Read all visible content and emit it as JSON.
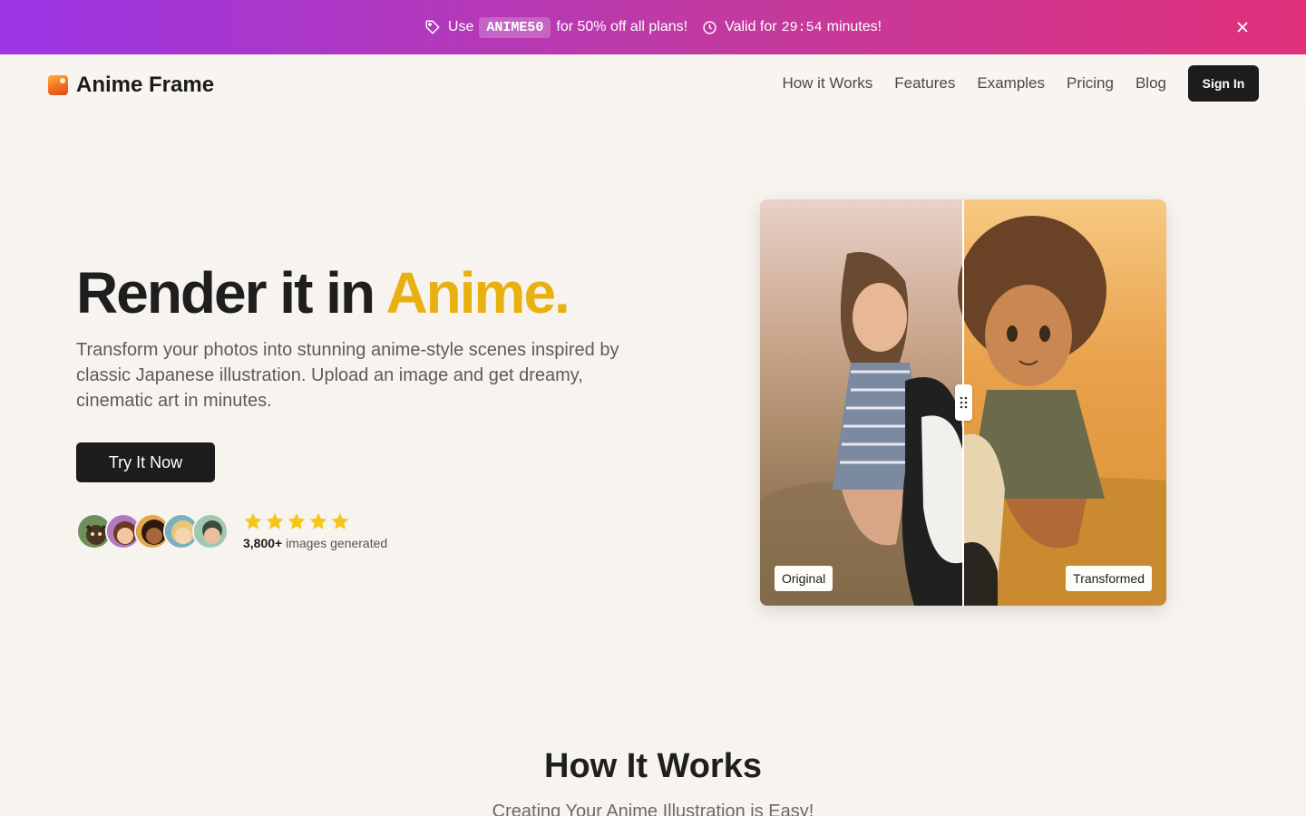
{
  "promo": {
    "use_text": "Use",
    "code": "ANIME50",
    "offer_text": "for 50% off all plans!",
    "valid_prefix": "Valid for",
    "timer": "29:54",
    "valid_suffix": "minutes!",
    "icons": {
      "tag": "tag-icon",
      "clock": "clock-icon",
      "close": "close-icon"
    },
    "gradient": [
      "#9b35e6",
      "#e0307a"
    ]
  },
  "nav": {
    "brand": "Anime Frame",
    "links": [
      "How it Works",
      "Features",
      "Examples",
      "Pricing",
      "Blog"
    ],
    "signin": "Sign In"
  },
  "hero": {
    "title_main": "Render it in ",
    "title_accent": "Anime.",
    "accent_color": "#e8b10f",
    "subtitle": "Transform your photos into stunning anime-style scenes inspired by classic Japanese illustration. Upload an image and get dreamy, cinematic art in minutes.",
    "cta": "Try It Now",
    "rating_stars": 5,
    "count": "3,800+",
    "count_label": "images generated"
  },
  "compare": {
    "left_label": "Original",
    "right_label": "Transformed"
  },
  "how": {
    "title": "How It Works",
    "subtitle": "Creating Your Anime Illustration is Easy!"
  }
}
